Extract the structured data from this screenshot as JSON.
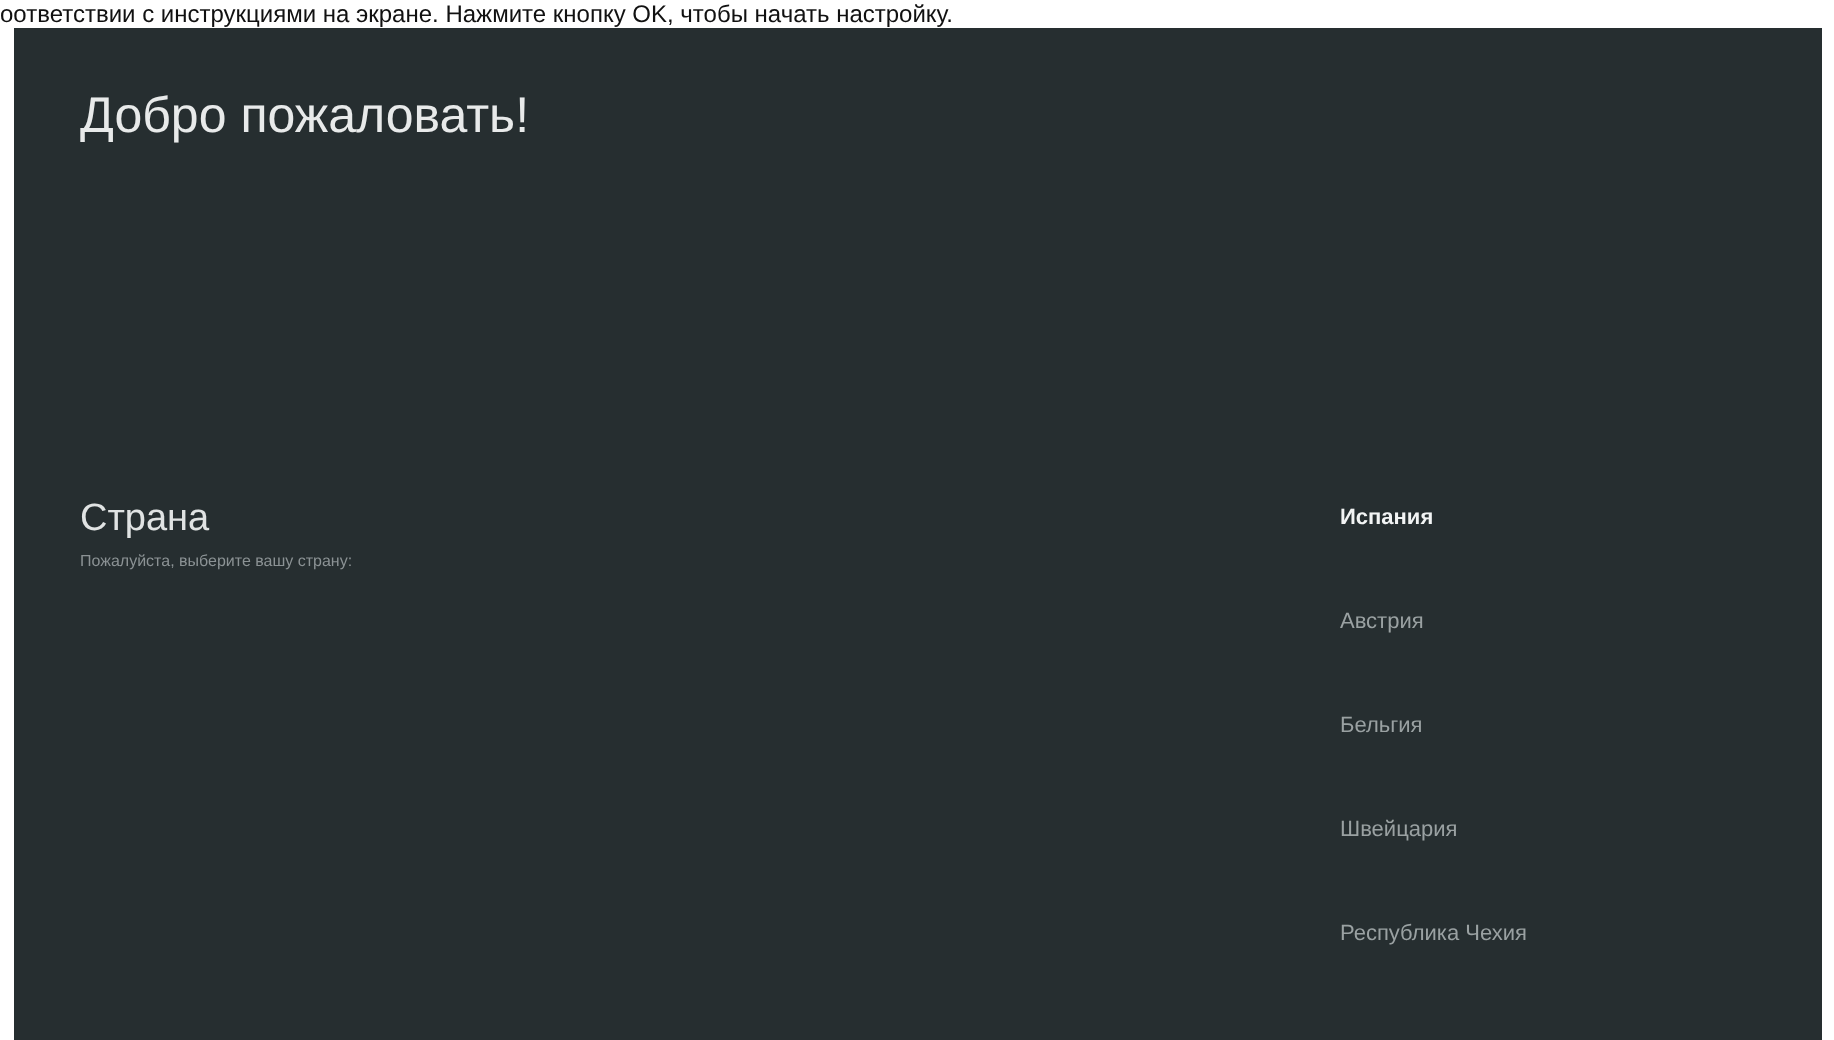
{
  "instruction_text": "оответствии с инструкциями на экране. Нажмите кнопку OK, чтобы начать настройку.",
  "title": "Добро пожаловать!",
  "section": {
    "heading": "Страна",
    "subtitle": "Пожалуйста, выберите вашу страну:"
  },
  "countries": [
    {
      "label": "Испания",
      "selected": true
    },
    {
      "label": "Австрия",
      "selected": false
    },
    {
      "label": "Бельгия",
      "selected": false
    },
    {
      "label": "Швейцария",
      "selected": false
    },
    {
      "label": "Республика Чехия",
      "selected": false
    }
  ]
}
